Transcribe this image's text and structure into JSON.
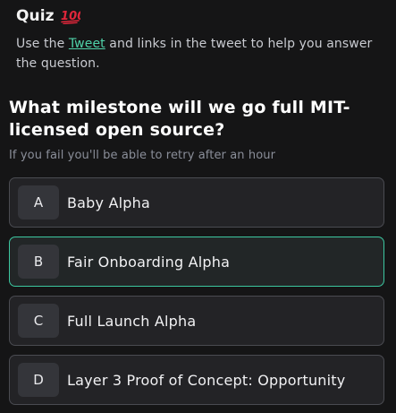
{
  "quiz": {
    "title": "Quiz",
    "title_icon": "hundred-points-icon",
    "instructions_before": "Use the ",
    "link_text": "Tweet",
    "instructions_after": " and links in the tweet to help you answer the question.",
    "question": "What milestone will we go full MIT-licensed open source?",
    "retry_note": "If you fail you'll be able to retry after an hour"
  },
  "options": [
    {
      "letter": "A",
      "label": "Baby Alpha",
      "selected": false
    },
    {
      "letter": "B",
      "label": "Fair Onboarding Alpha",
      "selected": true
    },
    {
      "letter": "C",
      "label": "Full Launch Alpha",
      "selected": false
    },
    {
      "letter": "D",
      "label": "Layer 3 Proof of Concept: Opportunity",
      "selected": false
    }
  ],
  "colors": {
    "background": "#151516",
    "accent": "#3cc7a0",
    "link": "#4fd1a8",
    "option_bg": "#232326",
    "letter_bg": "#34353a",
    "emoji_red": "#e0263a"
  }
}
